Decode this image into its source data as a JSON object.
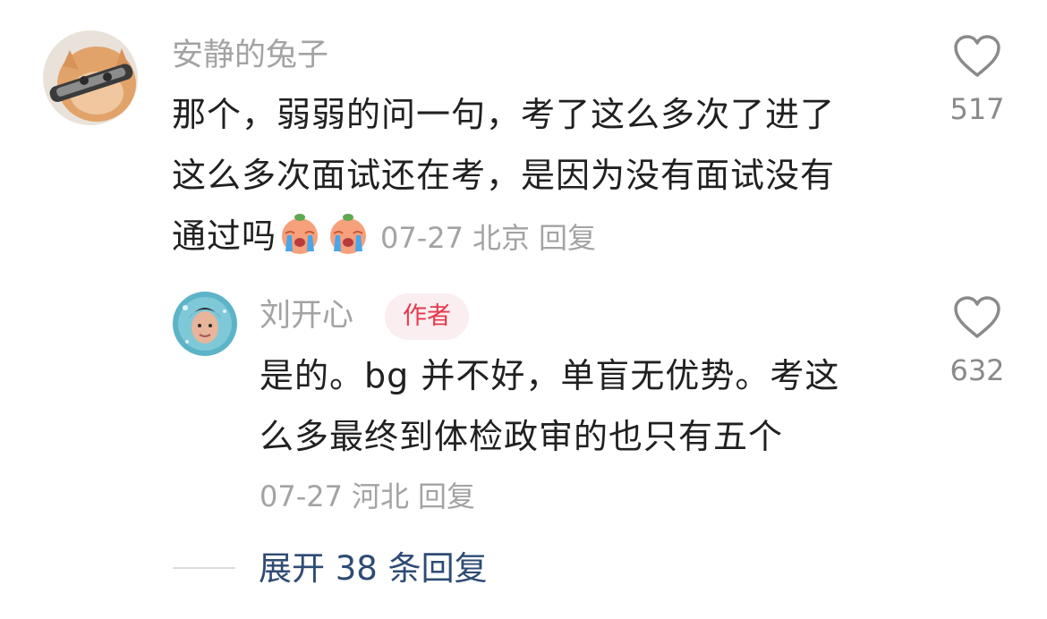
{
  "comment": {
    "username": "安静的兔子",
    "lines": [
      "那个，弱弱的问一句，考了这么多次了进了",
      "这么多次面试还在考，是因为没有面试没有",
      "通过吗"
    ],
    "emojis": [
      "crying-face-emoji",
      "crying-face-emoji"
    ],
    "date": "07-27",
    "location": "北京",
    "reply_label": "回复",
    "like_count": "517",
    "like_icon": "heart-outline-icon"
  },
  "reply": {
    "username": "刘开心",
    "badge": "作者",
    "lines": [
      "是的。bg 并不好，单盲无优势。考这",
      "么多最终到体检政审的也只有五个"
    ],
    "date": "07-27",
    "location": "河北",
    "reply_label": "回复",
    "like_count": "632",
    "like_icon": "heart-outline-icon"
  },
  "expand": {
    "label": "展开 38 条回复"
  },
  "colors": {
    "meta_gray": "#a3a3a3",
    "text": "#202020",
    "badge_text": "#e3394d",
    "badge_bg": "#fbeef0",
    "link_blue": "#2e4b74"
  }
}
